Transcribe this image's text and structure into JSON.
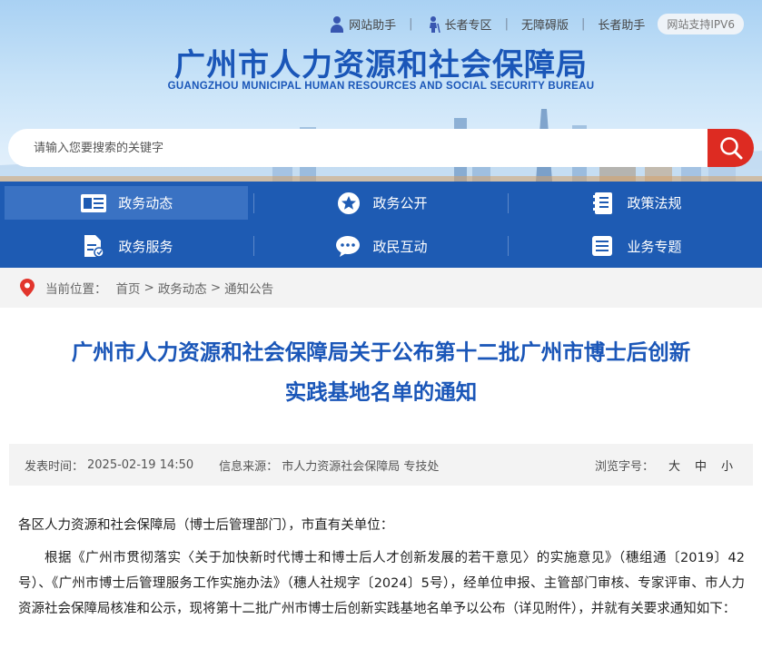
{
  "top_links": {
    "site_helper": "网站助手",
    "elder_zone": "长者专区",
    "accessibility": "无障碍版",
    "elder_helper": "长者助手",
    "ipv6": "网站支持IPV6"
  },
  "header": {
    "title_cn": "广州市人力资源和社会保障局",
    "title_en": "GUANGZHOU MUNICIPAL HUMAN RESOURCES AND SOCIAL SECURITY BUREAU"
  },
  "search": {
    "placeholder": "请输入您要搜索的关键字"
  },
  "nav": {
    "items": [
      {
        "label": "政务动态",
        "icon": "news-icon"
      },
      {
        "label": "政务公开",
        "icon": "star-icon"
      },
      {
        "label": "政策法规",
        "icon": "book-icon"
      },
      {
        "label": "政务服务",
        "icon": "document-icon"
      },
      {
        "label": "政民互动",
        "icon": "chat-icon"
      },
      {
        "label": "业务专题",
        "icon": "list-icon"
      }
    ]
  },
  "breadcrumb": {
    "prefix": "当前位置：",
    "home": "首页",
    "level1": "政务动态",
    "level2": "通知公告",
    "separator": ">"
  },
  "article": {
    "title_line1": "广州市人力资源和社会保障局关于公布第十二批广州市博士后创新",
    "title_line2": "实践基地名单的通知",
    "published_label": "发表时间：",
    "published_value": "2025-02-19 14:50",
    "source_label": "信息来源：",
    "source_value": "市人力资源社会保障局 专技处",
    "font_size_label": "浏览字号：",
    "font_sizes": [
      "大",
      "中",
      "小"
    ],
    "paragraphs": [
      "各区人力资源和社会保障局（博士后管理部门），市直有关单位：",
      "根据《广州市贯彻落实〈关于加快新时代博士和博士后人才创新发展的若干意见〉的实施意见》（穗组通〔2019〕42号）、《广州市博士后管理服务工作实施办法》（穗人社规字〔2024〕5号），经单位申报、主管部门审核、专家评审、市人力资源社会保障局核准和公示，现将第十二批广州市博士后创新实践基地名单予以公布（详见附件），并就有关要求通知如下："
    ]
  },
  "colors": {
    "brand_blue": "#1a56b8",
    "nav_blue": "#1e5bb3",
    "search_red": "#dd2b22"
  }
}
